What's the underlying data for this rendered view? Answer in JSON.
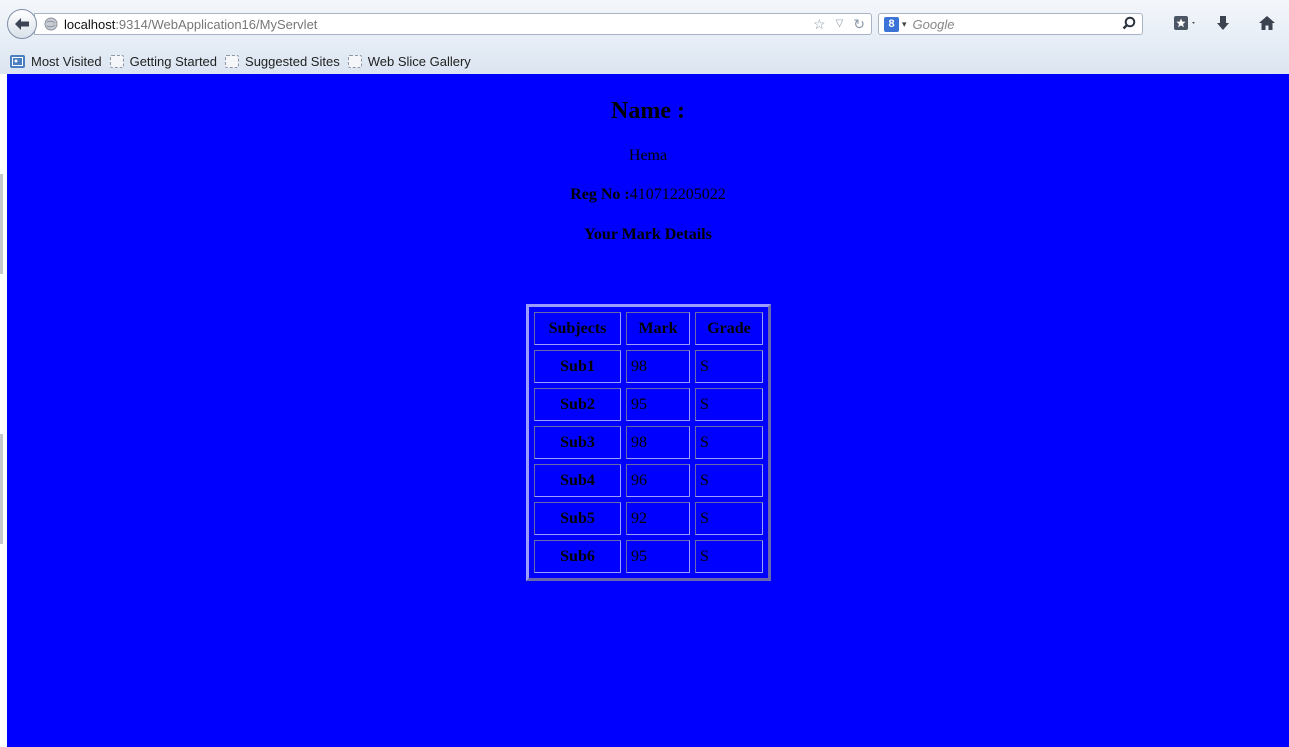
{
  "browser": {
    "url_host": "localhost",
    "url_path": ":9314/WebApplication16/MyServlet",
    "search_placeholder": "Google",
    "search_engine_label": "8",
    "bookmarks": [
      {
        "label": "Most Visited"
      },
      {
        "label": "Getting Started"
      },
      {
        "label": "Suggested Sites"
      },
      {
        "label": "Web Slice Gallery"
      }
    ]
  },
  "page": {
    "background_color": "#0000ff",
    "name_heading": "Name :",
    "name_value": "Hema",
    "reg_label": "Reg No :",
    "reg_value": "410712205022",
    "mark_heading": "Your Mark Details",
    "table": {
      "headers": [
        "Subjects",
        "Mark",
        "Grade"
      ],
      "rows": [
        {
          "subject": "Sub1",
          "mark": "98",
          "grade": "S"
        },
        {
          "subject": "Sub2",
          "mark": "95",
          "grade": "S"
        },
        {
          "subject": "Sub3",
          "mark": "98",
          "grade": "S"
        },
        {
          "subject": "Sub4",
          "mark": "96",
          "grade": "S"
        },
        {
          "subject": "Sub5",
          "mark": "92",
          "grade": "S"
        },
        {
          "subject": "Sub6",
          "mark": "95",
          "grade": "S"
        }
      ]
    }
  }
}
